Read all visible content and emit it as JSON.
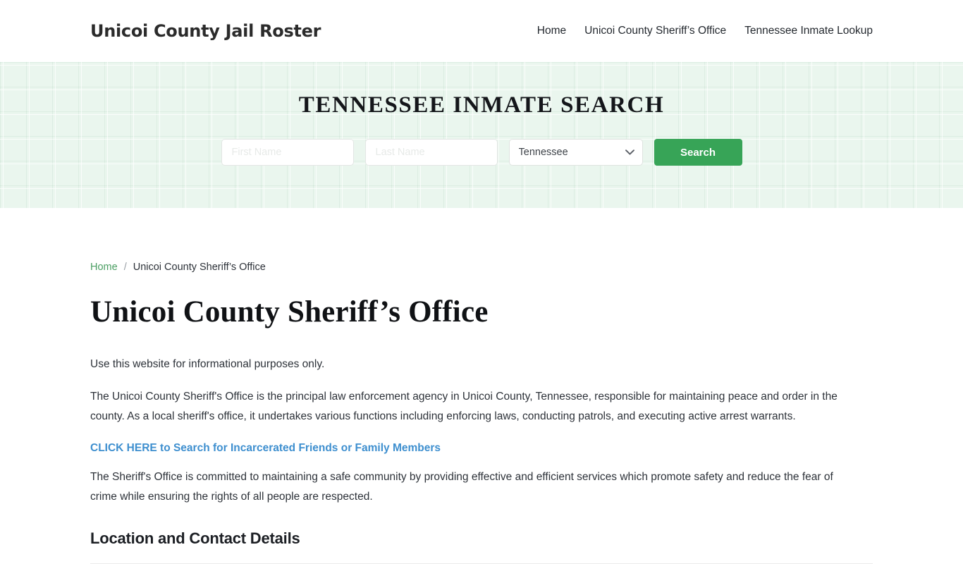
{
  "header": {
    "brand": "Unicoi County Jail Roster",
    "nav": [
      {
        "label": "Home"
      },
      {
        "label": "Unicoi County Sheriff’s Office"
      },
      {
        "label": "Tennessee Inmate Lookup"
      }
    ]
  },
  "hero": {
    "title": "TENNESSEE INMATE SEARCH",
    "background_color": "#eaf6ee",
    "form": {
      "first_name_placeholder": "First Name",
      "first_name_value": "",
      "last_name_placeholder": "Last Name",
      "last_name_value": "",
      "state_selected": "Tennessee",
      "state_options": [
        "Tennessee"
      ],
      "chevron_icon": "chevron-down-icon",
      "search_label": "Search",
      "search_button_color": "#37a457"
    }
  },
  "breadcrumb": {
    "home": "Home",
    "separator": "/",
    "current": "Unicoi County Sheriff’s Office",
    "link_color": "#4a9e62"
  },
  "main": {
    "page_title": "Unicoi County Sheriff’s Office",
    "lead": "Use this website for informational purposes only.",
    "paragraph_1": "The Unicoi County Sheriff's Office is the principal law enforcement agency in Unicoi County, Tennessee, responsible for maintaining peace and order in the county. As a local sheriff's office, it undertakes various functions including enforcing laws, conducting patrols, and executing active arrest warrants.",
    "cta_link": "CLICK HERE to Search for Incarcerated Friends or Family Members",
    "cta_color": "#3e8fcf",
    "paragraph_2": "The Sheriff's Office is committed to maintaining a safe community by providing effective and efficient services which promote safety and reduce the fear of crime while ensuring the rights of all people are respected.",
    "section_title": "Location and Contact Details"
  }
}
